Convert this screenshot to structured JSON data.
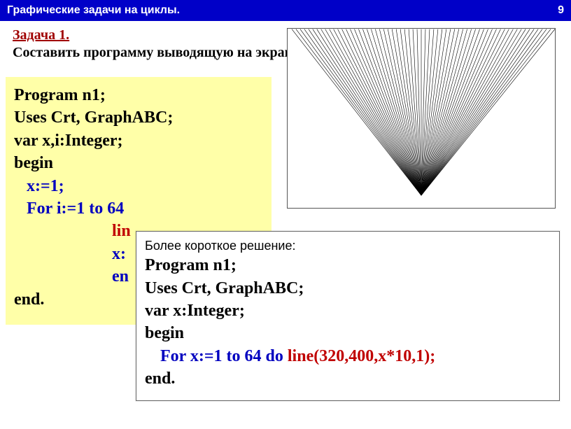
{
  "header": {
    "title": "Графические задачи на циклы.",
    "page": "9"
  },
  "task": {
    "num": "Задача 1.",
    "desc": "Составить программу выводящую на экран следующее изображение"
  },
  "code1": {
    "l1": "Program n1;",
    "l2": "Uses Crt, GraphABC;",
    "l3": "var x,i:Integer;",
    "l4": "begin",
    "l5": "x:=1;",
    "l6a": "For i:=1 to 64",
    "l7": "lin",
    "l8": "x:",
    "l9": "en",
    "l10": "end."
  },
  "code2": {
    "caption": "Более короткое решение:",
    "l1": "Program n1;",
    "l2": "Uses Crt, GraphABC;",
    "l3": "var x:Integer;",
    "l4": "begin",
    "l5a": "For x:=1 to 64 do ",
    "l5b": "line(320,400,x*10,1);",
    "l6": "end."
  },
  "chart_data": {
    "type": "line-fan",
    "description": "Lines from apex (320,400) to points (x*10, 1) for x in 1..64 in a 640×480-like canvas.",
    "apex": [
      320,
      400
    ],
    "x_range": [
      1,
      64
    ],
    "target_y": 1,
    "target_x_mul": 10,
    "count": 64
  }
}
